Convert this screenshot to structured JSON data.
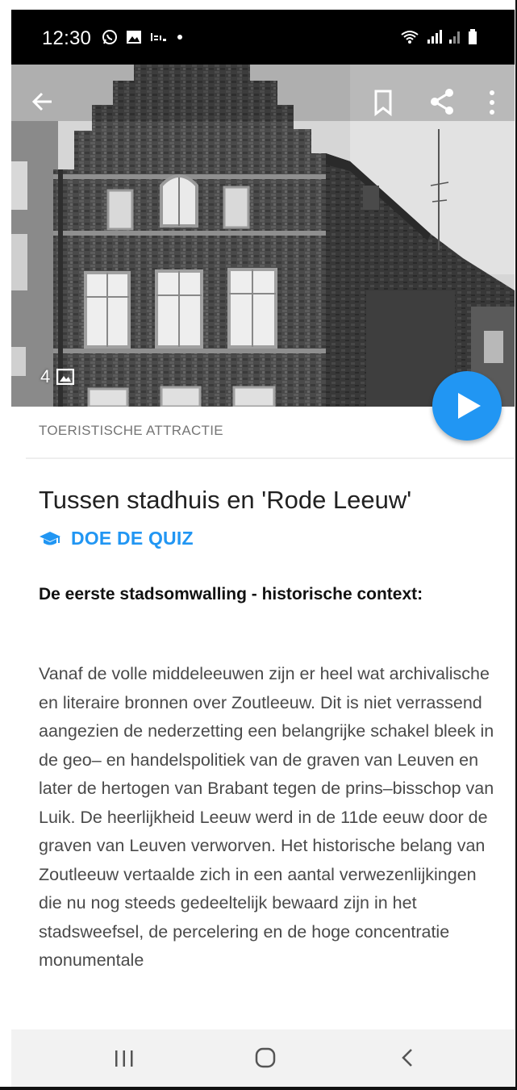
{
  "status_bar": {
    "time": "12:30"
  },
  "hero": {
    "photo_count": "4"
  },
  "content": {
    "category": "TOERISTISCHE ATTRACTIE",
    "title": "Tussen stadhuis en 'Rode Leeuw'",
    "quiz_label": "DOE DE QUIZ",
    "subheading": "De eerste stadsomwalling - historische context:",
    "body_text": "Vanaf de volle middeleeuwen zijn er heel wat archivalische en literaire bronnen over Zoutleeuw. Dit is niet verrassend aangezien de nederzetting een belangrijke schakel bleek in de geo– en handelspolitiek van de graven van Leuven en later de hertogen van Brabant tegen de prins–bisschop van Luik. De heerlijkheid Leeuw werd in de 11de eeuw door de graven van Leuven verworven. Het historische belang van Zoutleeuw vertaalde zich in een aantal verwezenlijkingen die nu nog steeds gedeeltelijk bewaard zijn in het stadsweefsel, de percelering en de hoge concentratie monumentale"
  },
  "colors": {
    "accent": "#2196f3",
    "status_bar": "#000000",
    "nav_bar": "#f2f2f2"
  }
}
